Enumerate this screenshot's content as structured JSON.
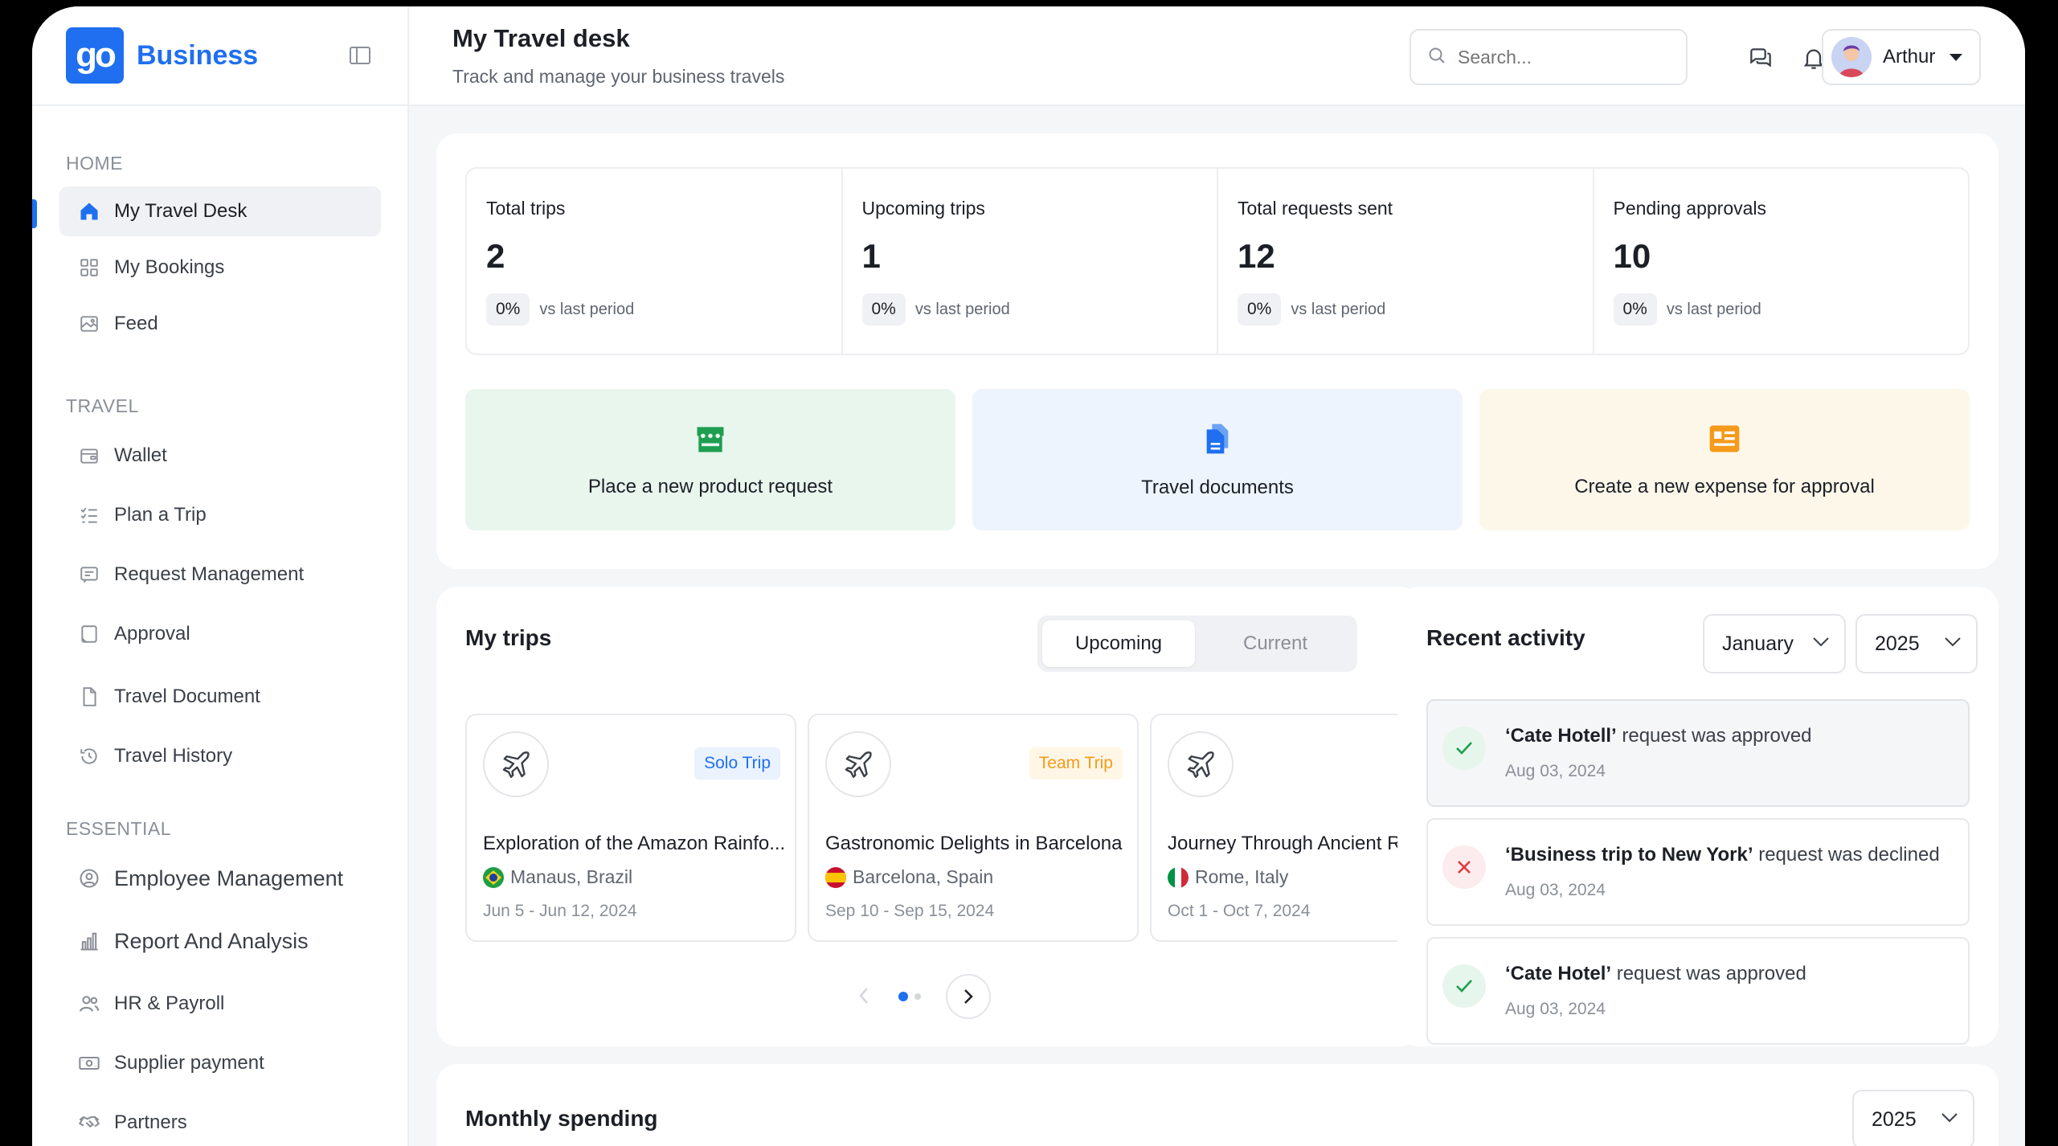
{
  "brand": {
    "name": "Business",
    "logo_text": "go"
  },
  "sidebar": {
    "sections": [
      {
        "label": "HOME",
        "items": [
          {
            "label": "My Travel Desk",
            "icon": "home-icon"
          },
          {
            "label": "My Bookings",
            "icon": "grid-icon"
          },
          {
            "label": "Feed",
            "icon": "image-icon"
          }
        ]
      },
      {
        "label": "TRAVEL",
        "items": [
          {
            "label": "Wallet",
            "icon": "wallet-icon"
          },
          {
            "label": "Plan a Trip",
            "icon": "checklist-icon"
          },
          {
            "label": "Request Management",
            "icon": "message-icon"
          },
          {
            "label": "Approval",
            "icon": "approval-icon"
          },
          {
            "label": "Travel Document",
            "icon": "document-icon"
          },
          {
            "label": "Travel History",
            "icon": "history-icon"
          }
        ]
      },
      {
        "label": "ESSENTIAL",
        "items": [
          {
            "label": "Employee Management",
            "icon": "employee-icon"
          },
          {
            "label": "Report And Analysis",
            "icon": "chart-icon"
          },
          {
            "label": "HR & Payroll",
            "icon": "users-icon"
          },
          {
            "label": "Supplier payment",
            "icon": "money-icon"
          },
          {
            "label": "Partners",
            "icon": "handshake-icon"
          }
        ]
      }
    ]
  },
  "header": {
    "title": "My Travel desk",
    "subtitle": "Track and manage your business travels",
    "search_placeholder": "Search...",
    "user_name": "Arthur"
  },
  "stats": [
    {
      "label": "Total trips",
      "value": "2",
      "change": "0%",
      "note": "vs last period"
    },
    {
      "label": "Upcoming trips",
      "value": "1",
      "change": "0%",
      "note": "vs last period"
    },
    {
      "label": "Total requests sent",
      "value": "12",
      "change": "0%",
      "note": "vs last period"
    },
    {
      "label": "Pending approvals",
      "value": "10",
      "change": "0%",
      "note": "vs last period"
    }
  ],
  "actions": [
    {
      "label": "Place a new product request",
      "icon": "store-icon",
      "bg": "#e8f6ee",
      "color": "#1e9e50"
    },
    {
      "label": "Travel documents",
      "icon": "file-icon",
      "bg": "#eef4fd",
      "color": "#1f6ff0"
    },
    {
      "label": "Create a new expense for approval",
      "icon": "receipt-icon",
      "bg": "#fdf7ea",
      "color": "#f59a1b"
    }
  ],
  "trips": {
    "title": "My trips",
    "tabs": [
      "Upcoming",
      "Current"
    ],
    "items": [
      {
        "name": "Exploration of the Amazon Rainfo...",
        "badge": "Solo Trip",
        "location": "Manaus, Brazil",
        "dates": "Jun 5 - Jun 12, 2024"
      },
      {
        "name": "Gastronomic Delights in Barcelona",
        "badge": "Team Trip",
        "location": "Barcelona, Spain",
        "dates": "Sep 10 - Sep 15, 2024"
      },
      {
        "name": "Journey Through Ancient Rome",
        "badge": "",
        "location": "Rome, Italy",
        "dates": "Oct 1 - Oct 7, 2024"
      }
    ]
  },
  "activity": {
    "title": "Recent activity",
    "month": "January",
    "year": "2025",
    "items": [
      {
        "subject": "‘Cate Hotell’",
        "text": " request was approved",
        "date": "Aug 03, 2024",
        "status": "approved"
      },
      {
        "subject": "‘Business trip to New York’",
        "text": " request was declined",
        "date": "Aug 03, 2024",
        "status": "declined"
      },
      {
        "subject": "‘Cate Hotel’",
        "text": " request was approved",
        "date": "Aug 03, 2024",
        "status": "approved"
      }
    ]
  },
  "spending": {
    "title": "Monthly spending",
    "year": "2025"
  },
  "colors": {
    "accent": "#1f6ff0",
    "approved": "#1e9e50",
    "declined": "#e0383e"
  }
}
